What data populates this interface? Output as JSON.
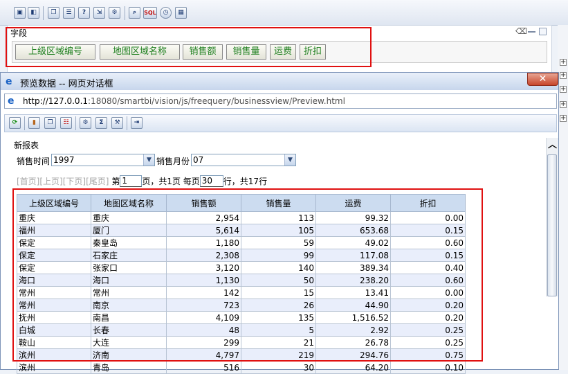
{
  "app": {
    "toolbar_icons": [
      "save-icon",
      "save-as-icon",
      "window-icon",
      "table-icon",
      "help-icon",
      "import-icon",
      "settings-icon",
      "search-icon",
      "sql-icon",
      "clock-icon",
      "grid-icon"
    ],
    "sql_label": "SQL"
  },
  "field_panel": {
    "title": "字段",
    "fields": [
      "上级区域编号",
      "地图区域名称",
      "销售额",
      "销售量",
      "运费",
      "折扣"
    ]
  },
  "dialog": {
    "title": "预览数据 -- 网页对话框",
    "close_label": "✕",
    "url_host": "http://127.0.0.1",
    "url_rest": ":18080/smartbi/vision/js/freequery/businessview/Preview.html"
  },
  "report": {
    "title": "新报表",
    "param1_label": "销售时间",
    "param1_value": "1997",
    "param2_label": "销售月份",
    "param2_value": "07",
    "pager": {
      "first": "[首页]",
      "prev": "[上页]",
      "next": "[下页]",
      "last": "[尾页]",
      "page_prefix": "第",
      "page_value": "1",
      "page_suffix": "页，共1页 每页",
      "size_value": "30",
      "size_suffix": "行，共17行"
    },
    "columns": [
      "上级区域编号",
      "地图区域名称",
      "销售额",
      "销售量",
      "运费",
      "折扣"
    ],
    "rows": [
      [
        "重庆",
        "重庆",
        "2,954",
        "113",
        "99.32",
        "0.00"
      ],
      [
        "福州",
        "厦门",
        "5,614",
        "105",
        "653.68",
        "0.15"
      ],
      [
        "保定",
        "秦皇岛",
        "1,180",
        "59",
        "49.02",
        "0.60"
      ],
      [
        "保定",
        "石家庄",
        "2,308",
        "99",
        "117.08",
        "0.15"
      ],
      [
        "保定",
        "张家口",
        "3,120",
        "140",
        "389.34",
        "0.40"
      ],
      [
        "海口",
        "海口",
        "1,130",
        "50",
        "238.20",
        "0.60"
      ],
      [
        "常州",
        "常州",
        "142",
        "15",
        "13.41",
        "0.00"
      ],
      [
        "常州",
        "南京",
        "723",
        "26",
        "44.90",
        "0.20"
      ],
      [
        "抚州",
        "南昌",
        "4,109",
        "135",
        "1,516.52",
        "0.20"
      ],
      [
        "白城",
        "长春",
        "48",
        "5",
        "2.92",
        "0.25"
      ],
      [
        "鞍山",
        "大连",
        "299",
        "21",
        "26.78",
        "0.25"
      ],
      [
        "滨州",
        "济南",
        "4,797",
        "219",
        "294.76",
        "0.75"
      ],
      [
        "滨州",
        "青岛",
        "516",
        "30",
        "64.20",
        "0.10"
      ]
    ]
  }
}
